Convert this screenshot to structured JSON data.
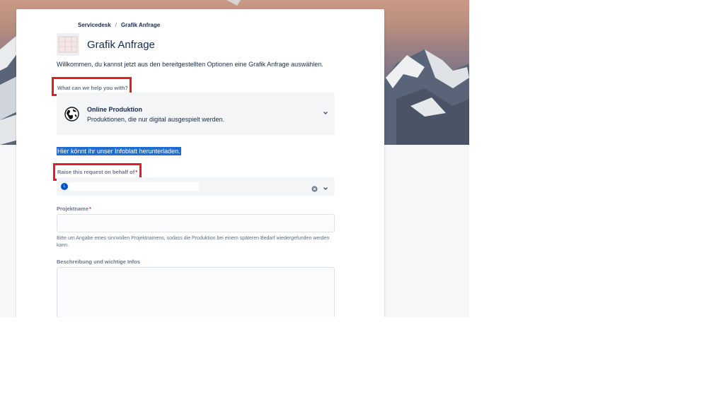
{
  "breadcrumb": {
    "items": [
      "Servicedesk",
      "Grafik Anfrage"
    ],
    "separator": "/"
  },
  "header": {
    "title": "Grafik Anfrage",
    "intro": "Willkommen, du kannst jetzt aus den bereitgestellten Optionen eine Grafik Anfrage auswählen."
  },
  "request_type": {
    "label": "What can we help you with?",
    "selected_title": "Online Produktion",
    "selected_description": "Produktionen, die nur digital ausgespielt werden.",
    "icon": "globe-icon"
  },
  "info_link": "Hier könnt ihr unser Infoblatt herunterladen.",
  "on_behalf": {
    "label": "Raise this request on behalf of",
    "required_mark": "*",
    "avatar_initial": "L"
  },
  "projektname": {
    "label": "Projektname",
    "required_mark": "*",
    "value": "",
    "help": "Bitte um Angabe eines sinnvollen Projektnamens, sodass die Produktion bei einem späteren Bedarf wiedergefunden werden kann."
  },
  "beschreibung": {
    "label": "Beschreibung und wichtige Infos",
    "value": ""
  },
  "colors": {
    "highlight_box": "#e01e2a",
    "link_selection": "#1e6ed1",
    "required": "#de350b"
  }
}
